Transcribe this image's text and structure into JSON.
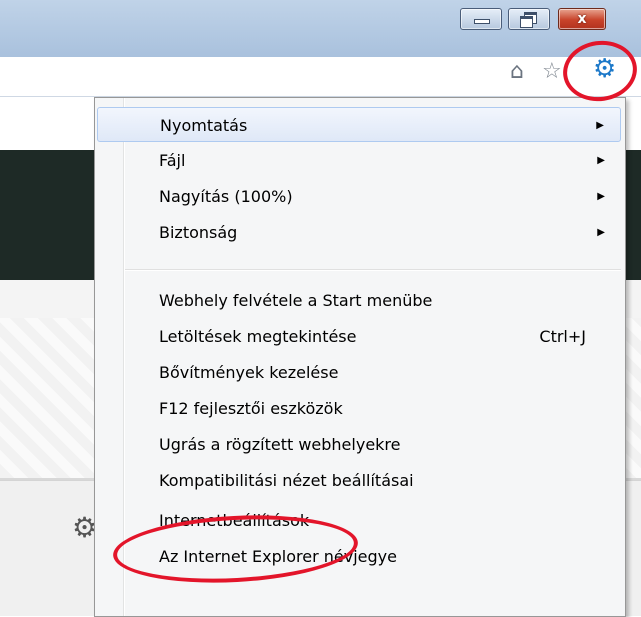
{
  "window": {
    "minimize_icon": "minimize-icon",
    "restore_icon": "restore-icon",
    "close_icon": "close-icon",
    "close_glyph": "x"
  },
  "toolbar": {
    "home_icon": "home-icon",
    "favorites_icon": "star-icon",
    "tools_icon": "gear-icon",
    "home_glyph": "⌂",
    "star_glyph": "☆",
    "gear_glyph": "⚙"
  },
  "page": {
    "partial_icon": "gear-icon",
    "partial_glyph": "⚙"
  },
  "menu": {
    "group1": [
      {
        "label": "Nyomtatás",
        "submenu": true,
        "highlighted": true
      },
      {
        "label": "Fájl",
        "submenu": true
      },
      {
        "label": "Nagyítás (100%)",
        "submenu": true
      },
      {
        "label": "Biztonság",
        "submenu": true
      }
    ],
    "group2": [
      {
        "label": "Webhely felvétele a Start menübe"
      },
      {
        "label": "Letöltések megtekintése",
        "shortcut": "Ctrl+J"
      },
      {
        "label": "Bővítmények kezelése"
      },
      {
        "label": "F12 fejlesztői eszközök"
      },
      {
        "label": "Ugrás a rögzített webhelyekre"
      },
      {
        "label": "Kompatibilitási nézet beállításai"
      },
      {
        "label": "Internetbeállítások"
      },
      {
        "label": "Az Internet Explorer névjegye"
      }
    ],
    "submenu_arrow": "▶"
  },
  "annotations": {
    "color": "#e3152a"
  },
  "colors": {
    "titlebar": "#b3c9e2",
    "menu_bg": "#f5f6f7",
    "page_dark": "#1e2a26",
    "gear_blue": "#1d79c9",
    "close_red": "#c8432a"
  }
}
